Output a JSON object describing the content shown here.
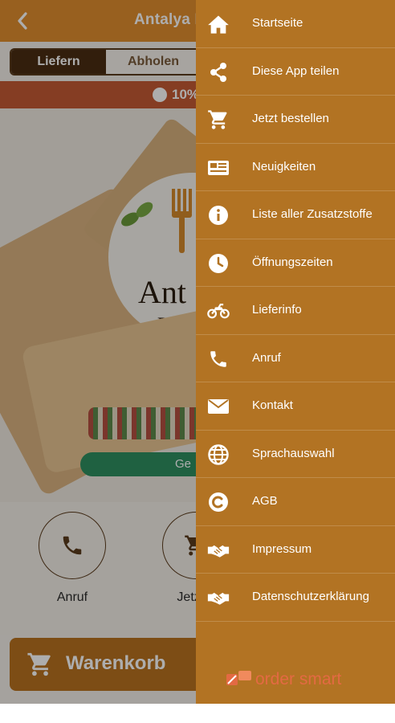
{
  "header": {
    "title": "Antalya R",
    "back_icon": "chevron-left-icon"
  },
  "order_mode": {
    "options": [
      "Liefern",
      "Abholen"
    ],
    "selected": "Liefern"
  },
  "promo": {
    "text": "10%"
  },
  "hero": {
    "brand": "Ant",
    "brand_sub": "Resta",
    "status_pill": "Ge"
  },
  "quick_actions": [
    {
      "label": "Anruf",
      "icon": "phone-icon"
    },
    {
      "label": "Jetzt b",
      "icon": "cart-icon"
    }
  ],
  "cart_bar": {
    "label": "Warenkorb",
    "icon": "cart-icon"
  },
  "drawer": {
    "items": [
      {
        "label": "Startseite",
        "icon": "home-icon"
      },
      {
        "label": "Diese App teilen",
        "icon": "share-icon"
      },
      {
        "label": "Jetzt bestellen",
        "icon": "cart-icon"
      },
      {
        "label": "Neuigkeiten",
        "icon": "newspaper-icon"
      },
      {
        "label": "Liste aller Zusatzstoffe",
        "icon": "info-icon"
      },
      {
        "label": "Öffnungszeiten",
        "icon": "clock-icon"
      },
      {
        "label": "Lieferinfo",
        "icon": "motorcycle-icon"
      },
      {
        "label": "Anruf",
        "icon": "phone-icon"
      },
      {
        "label": "Kontakt",
        "icon": "envelope-icon"
      },
      {
        "label": "Sprachauswahl",
        "icon": "globe-icon"
      },
      {
        "label": "AGB",
        "icon": "copyright-icon"
      },
      {
        "label": "Impressum",
        "icon": "handshake-icon"
      },
      {
        "label": "Datenschutzerklärung",
        "icon": "handshake-icon"
      }
    ],
    "footer_logo": "order smart"
  },
  "colors": {
    "header": "#e08e2e",
    "drawer": "#b27323",
    "promo": "#c45a34",
    "cart": "#b8721f",
    "segment_active": "#4a2d12"
  }
}
